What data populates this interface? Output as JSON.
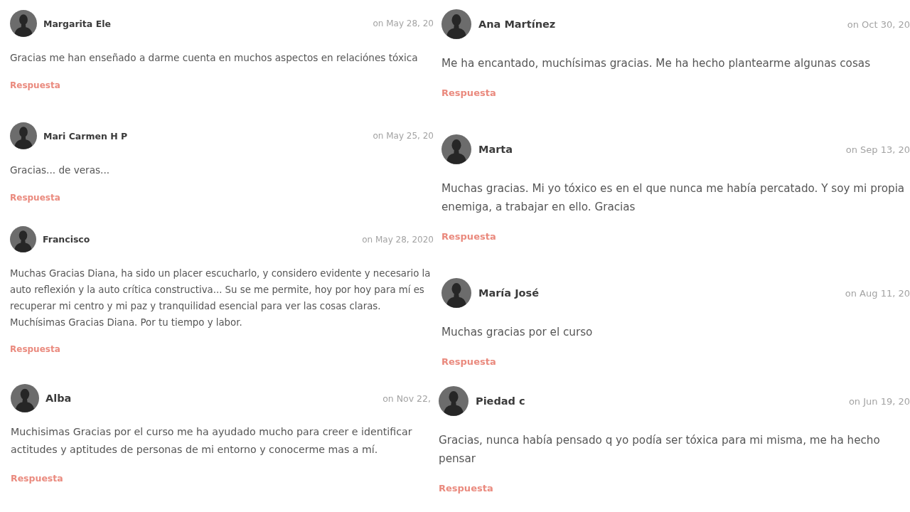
{
  "columns": [
    {
      "comments": [
        {
          "author": "Margarita Ele",
          "date": "on May 28, 20",
          "text": "Gracias me han enseñado a darme cuenta en muchos aspectos en relaciónes tóxica",
          "reply": "Respuesta"
        },
        {
          "author": "Mari Carmen H P",
          "date": "on May 25, 20",
          "text": "Gracias... de veras...",
          "reply": "Respuesta"
        },
        {
          "author": "Francisco",
          "date": "on May 28, 2020",
          "text": "Muchas Gracias Diana, ha sido un placer escucharlo, y considero evidente y necesario la auto reflexión y la auto crítica constructiva... Su se me permite, hoy por hoy para mí es recuperar mi centro y mi paz y tranquilidad esencial para ver las cosas claras. Muchísimas Gracias Diana. Por tu tiempo y labor.",
          "reply": "Respuesta"
        },
        {
          "author": "Alba",
          "date": "on Nov 22,",
          "text": "Muchisimas Gracias por el curso me ha ayudado mucho para creer e identificar actitudes y aptitudes de personas de mi entorno y conocerme mas a mí.",
          "reply": "Respuesta"
        }
      ]
    },
    {
      "comments": [
        {
          "author": "Ana Martínez",
          "date": "on Oct 30, 20",
          "text": "Me ha encantado, muchísimas gracias. Me ha hecho plantearme algunas cosas",
          "reply": "Respuesta"
        },
        {
          "author": "Marta",
          "date": "on Sep 13, 20",
          "text": "Muchas gracias. Mi yo tóxico es en el que nunca me había percatado. Y soy mi propia enemiga, a trabajar en ello. Gracias",
          "reply": "Respuesta"
        },
        {
          "author": "María José",
          "date": "on Aug 11, 20",
          "text": "Muchas gracias por el curso",
          "reply": "Respuesta"
        },
        {
          "author": "Piedad c",
          "date": "on Jun 19, 20",
          "text": "Gracias, nunca había pensado q yo podía ser tóxica para mi misma, me ha hecho pensar",
          "reply": "Respuesta"
        }
      ]
    }
  ]
}
